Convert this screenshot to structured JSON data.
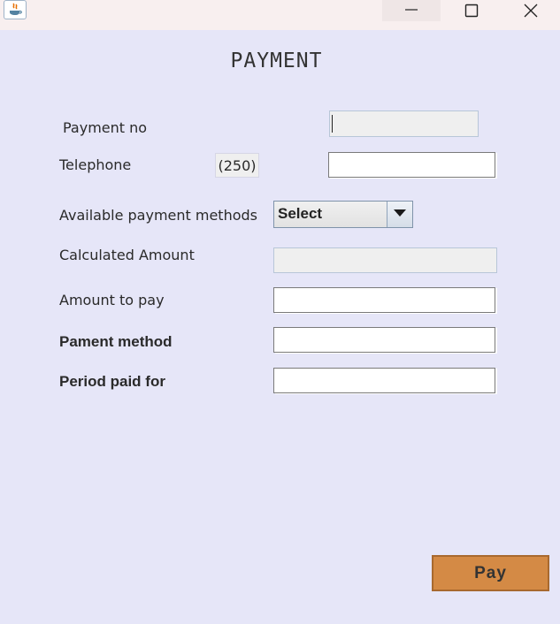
{
  "window": {
    "app_icon": "java-icon",
    "controls": [
      "minimize-icon",
      "maximize-icon",
      "close-icon"
    ]
  },
  "form": {
    "title": "PAYMENT",
    "payment_no": {
      "label": "Payment no",
      "value": ""
    },
    "telephone": {
      "label": "Telephone",
      "prefix": "(250)",
      "value": ""
    },
    "payment_methods": {
      "label": "Available payment methods",
      "selected": "Select"
    },
    "calculated_amount": {
      "label": "Calculated Amount",
      "value": ""
    },
    "amount_to_pay": {
      "label": "Amount to pay",
      "value": ""
    },
    "pament_method": {
      "label": "Pament method",
      "value": ""
    },
    "period_paid_for": {
      "label": "Period paid for",
      "value": ""
    },
    "pay_button": "Pay"
  },
  "colors": {
    "background": "#e6e6f8",
    "titlebar": "#f8efef",
    "pay_button": "#d48a45",
    "disabled_field": "#efefef"
  }
}
